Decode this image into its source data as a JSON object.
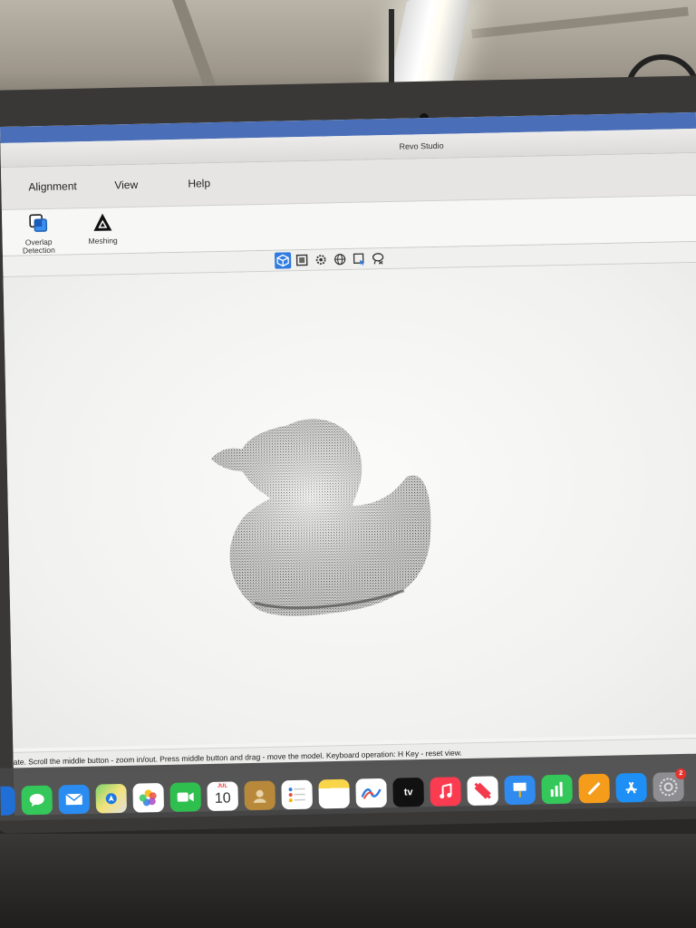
{
  "window": {
    "title": "Revo Studio"
  },
  "menu": {
    "items": [
      "Alignment",
      "View",
      "Help"
    ]
  },
  "toolbar": {
    "overlap_label_line1": "Overlap",
    "overlap_label_line2": "Detection",
    "meshing_label": "Meshing"
  },
  "view_toolbar": {
    "icons": [
      "cube-view-icon",
      "frame-icon",
      "gear-icon",
      "globe-icon",
      "select-icon",
      "lasso-icon"
    ],
    "active_icon": "cube-view-icon"
  },
  "viewport": {
    "model": "duck-point-cloud"
  },
  "status": {
    "text": "ate. Scroll the middle button - zoom in/out. Press middle button and drag - move the model. Keyboard operation: H Key - reset view."
  },
  "dock": {
    "calendar_month": "JUL",
    "calendar_day": "10",
    "tv_label": "tv",
    "settings_badge": "2"
  },
  "colors": {
    "accent": "#2f7be0",
    "title_strip": "#4a6fb8",
    "point_cloud": "#3a3a3a"
  }
}
